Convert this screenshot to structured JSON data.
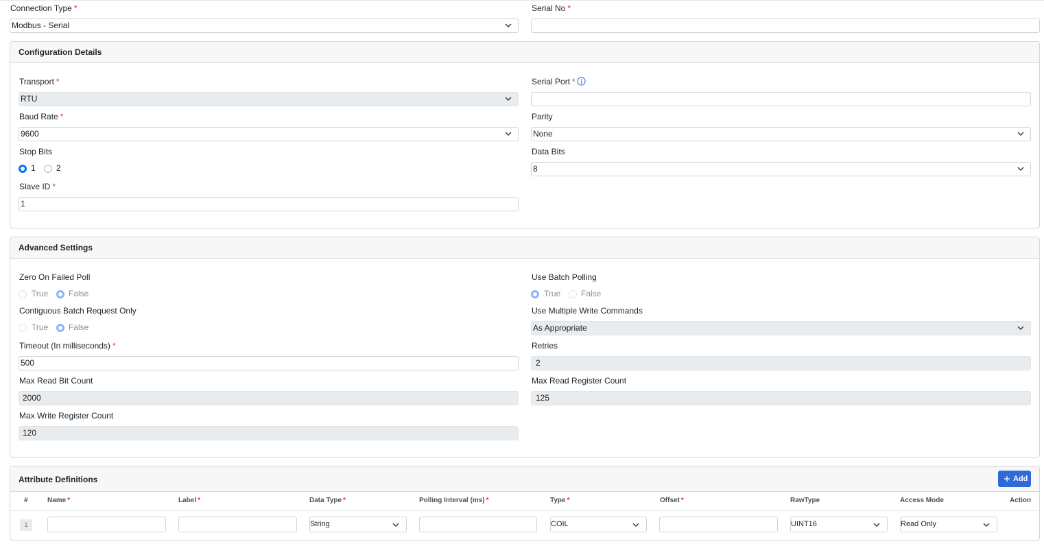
{
  "top": {
    "connection_type_label": "Connection Type",
    "connection_type_value": "Modbus - Serial",
    "serial_no_label": "Serial No",
    "serial_no_value": ""
  },
  "config": {
    "title": "Configuration Details",
    "transport_label": "Transport",
    "transport_value": "RTU",
    "serial_port_label": "Serial Port",
    "serial_port_value": "",
    "baud_rate_label": "Baud Rate",
    "baud_rate_value": "9600",
    "parity_label": "Parity",
    "parity_value": "None",
    "stop_bits_label": "Stop Bits",
    "stop_bits_options": [
      "1",
      "2"
    ],
    "stop_bits_selected": "1",
    "data_bits_label": "Data Bits",
    "data_bits_value": "8",
    "slave_id_label": "Slave ID",
    "slave_id_value": "1"
  },
  "advanced": {
    "title": "Advanced Settings",
    "zero_on_failed_poll_label": "Zero On Failed Poll",
    "zero_on_failed_poll_selected": "False",
    "use_batch_polling_label": "Use Batch Polling",
    "use_batch_polling_selected": "True",
    "contiguous_label": "Contiguous Batch Request Only",
    "contiguous_selected": "False",
    "multiple_write_label": "Use Multiple Write Commands",
    "multiple_write_value": "As Appropriate",
    "timeout_label": "Timeout (In milliseconds)",
    "timeout_value": "500",
    "retries_label": "Retries",
    "retries_value": "2",
    "max_read_bit_label": "Max Read Bit Count",
    "max_read_bit_value": "2000",
    "max_read_register_label": "Max Read Register Count",
    "max_read_register_value": "125",
    "max_write_register_label": "Max Write Register Count",
    "max_write_register_value": "120",
    "true_label": "True",
    "false_label": "False"
  },
  "attributes": {
    "title": "Attribute Definitions",
    "add_label": "Add",
    "columns": [
      "#",
      "Name",
      "Label",
      "Data Type",
      "Polling Interval (ms)",
      "Type",
      "Offset",
      "RawType",
      "Access Mode",
      "Action"
    ],
    "row": {
      "index": "1",
      "name": "",
      "label": "",
      "data_type": "String",
      "polling_interval": "",
      "type": "COIL",
      "offset": "",
      "raw_type": "UINT16",
      "access_mode": "Read Only"
    }
  },
  "colors": {
    "primary": "#0d6efd",
    "button": "#2f6bd8",
    "required": "#dc3545",
    "disabled_bg": "#e9ecef"
  }
}
